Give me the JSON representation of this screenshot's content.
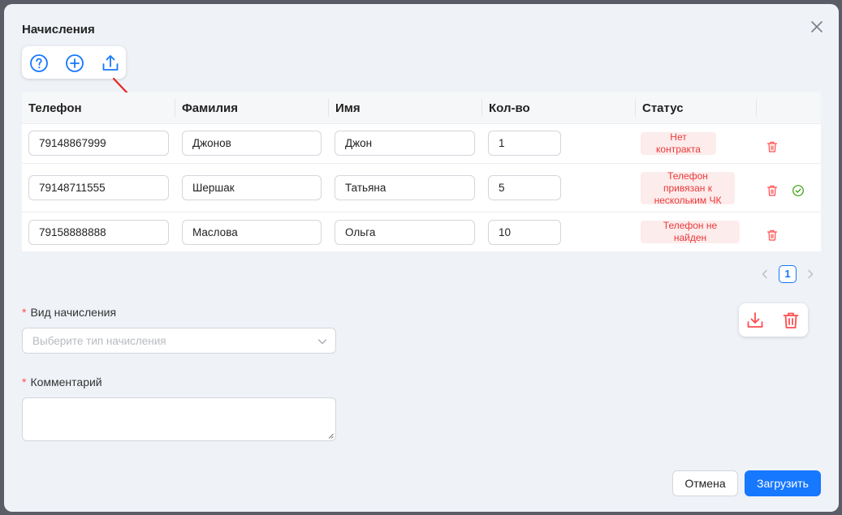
{
  "dialog": {
    "title": "Начисления"
  },
  "toolbar": {
    "icons": [
      "help-icon",
      "add-icon",
      "upload-icon"
    ]
  },
  "table": {
    "columns": [
      "Телефон",
      "Фамилия",
      "Имя",
      "Кол-во",
      "Статус"
    ],
    "rows": [
      {
        "phone": "79148867999",
        "last_name": "Джонов",
        "first_name": "Джон",
        "qty": "1",
        "status": "Нет контракта",
        "ok": false
      },
      {
        "phone": "79148711555",
        "last_name": "Шершак",
        "first_name": "Татьяна",
        "qty": "5",
        "status": "Телефон привязан к нескольким ЧК",
        "ok": true
      },
      {
        "phone": "79158888888",
        "last_name": "Маслова",
        "first_name": "Ольга",
        "qty": "10",
        "status": "Телефон не найден",
        "ok": false
      }
    ]
  },
  "pagination": {
    "current": "1"
  },
  "form": {
    "accrual_type": {
      "label": "Вид начисления",
      "placeholder": "Выберите тип начисления",
      "required_mark": "*"
    },
    "comment": {
      "label": "Комментарий",
      "value": "",
      "required_mark": "*"
    }
  },
  "file_actions": {
    "icons": [
      "download-icon",
      "trash-icon"
    ]
  },
  "footer": {
    "cancel_label": "Отмена",
    "submit_label": "Загрузить"
  },
  "colors": {
    "primary": "#1677ff",
    "danger": "#ff4d4f",
    "success": "#389e0d",
    "status_bg": "#fdecec"
  }
}
